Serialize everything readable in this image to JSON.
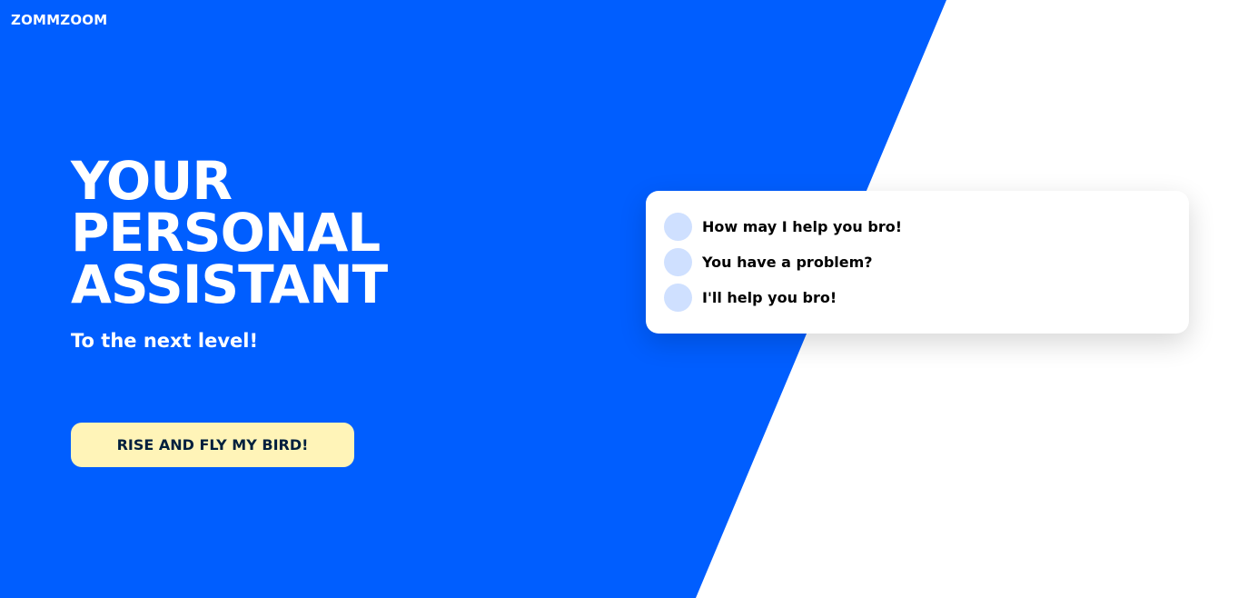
{
  "brand": {
    "logo": "ZOMMZOOM"
  },
  "hero": {
    "title_lines": [
      "YOUR",
      "PERSONAL",
      "ASSISTANT"
    ],
    "tagline": "To the next level!",
    "cta_label": "RISE AND FLY MY BIRD!"
  },
  "chat": {
    "messages": [
      "How may I help you bro!",
      "You have a problem?",
      "I'll help you bro!"
    ]
  },
  "colors": {
    "primary_blue": "#005eff",
    "cta_background": "#fff4b8",
    "avatar_placeholder": "#cfe0ff"
  }
}
